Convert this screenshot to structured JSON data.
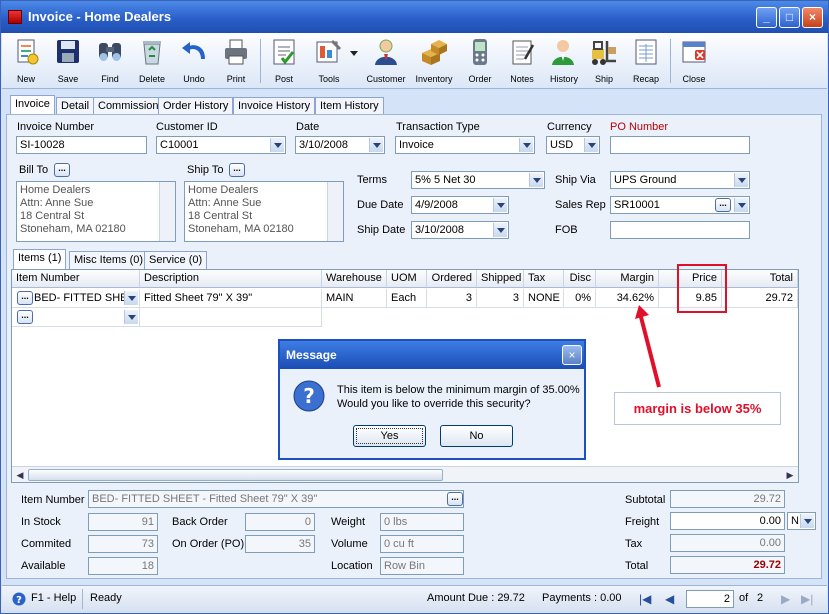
{
  "window": {
    "title": "Invoice - Home Dealers"
  },
  "toolbar": {
    "items": [
      {
        "label": "New",
        "icon": "new-document-icon"
      },
      {
        "label": "Save",
        "icon": "floppy-save-icon"
      },
      {
        "label": "Find",
        "icon": "binoculars-icon"
      },
      {
        "label": "Delete",
        "icon": "recycle-bin-icon"
      },
      {
        "label": "Undo",
        "icon": "undo-arrow-icon"
      },
      {
        "label": "Print",
        "icon": "printer-icon"
      },
      {
        "label": "Post",
        "icon": "post-check-icon"
      },
      {
        "label": "Tools",
        "icon": "tools-icon"
      },
      {
        "label": "Customer",
        "icon": "customer-icon"
      },
      {
        "label": "Inventory",
        "icon": "boxes-icon"
      },
      {
        "label": "Order",
        "icon": "order-device-icon"
      },
      {
        "label": "Notes",
        "icon": "notepad-icon"
      },
      {
        "label": "History",
        "icon": "history-person-icon"
      },
      {
        "label": "Ship",
        "icon": "forklift-icon"
      },
      {
        "label": "Recap",
        "icon": "recap-icon"
      },
      {
        "label": "Close",
        "icon": "close-window-icon"
      }
    ]
  },
  "tabs": [
    "Invoice",
    "Detail",
    "Commission",
    "Order History",
    "Invoice History",
    "Item History"
  ],
  "header": {
    "invoice_number_label": "Invoice Number",
    "invoice_number": "SI-10028",
    "customer_id_label": "Customer ID",
    "customer_id": "C10001",
    "date_label": "Date",
    "date": "3/10/2008",
    "transaction_type_label": "Transaction Type",
    "transaction_type": "Invoice",
    "currency_label": "Currency",
    "currency": "USD",
    "po_number_label": "PO Number",
    "po_number": ""
  },
  "bill_to": {
    "label": "Bill To",
    "lines": [
      "Home Dealers",
      "Attn: Anne Sue",
      "18 Central St",
      "Stoneham, MA 02180"
    ]
  },
  "ship_to": {
    "label": "Ship To",
    "lines": [
      "Home Dealers",
      "Attn: Anne Sue",
      "18 Central St",
      "Stoneham, MA 02180"
    ]
  },
  "terms": {
    "terms_label": "Terms",
    "terms": "5% 5 Net 30",
    "due_date_label": "Due Date",
    "due_date": "4/9/2008",
    "ship_date_label": "Ship Date",
    "ship_date": "3/10/2008",
    "ship_via_label": "Ship Via",
    "ship_via": "UPS Ground",
    "sales_rep_label": "Sales Rep",
    "sales_rep": "SR10001",
    "fob_label": "FOB",
    "fob": ""
  },
  "item_tabs": [
    "Items (1)",
    "Misc Items (0)",
    "Service (0)"
  ],
  "grid": {
    "columns": [
      "Item Number",
      "Description",
      "Warehouse",
      "UOM",
      "Ordered",
      "Shipped",
      "Tax",
      "Disc",
      "Margin",
      "Price",
      "Total"
    ],
    "rows": [
      {
        "item_number": "BED- FITTED SHEE",
        "description": "Fitted Sheet 79\" X 39\"",
        "warehouse": "MAIN",
        "uom": "Each",
        "ordered": "3",
        "shipped": "3",
        "tax": "NONE",
        "disc": "0%",
        "margin": "34.62%",
        "price": "9.85",
        "total": "29.72"
      }
    ]
  },
  "annotation": {
    "text": "margin is below 35%",
    "color": "#e0102a"
  },
  "dialog": {
    "title": "Message",
    "line1": "This item is below the minimum margin of 35.00%",
    "line2": "Would you like to override this security?",
    "yes": "Yes",
    "no": "No"
  },
  "footer": {
    "item_number_label": "Item Number",
    "item_number": "BED- FITTED SHEET - Fitted Sheet 79\" X 39\"",
    "in_stock_label": "In Stock",
    "in_stock": "91",
    "committed_label": "Commited",
    "committed": "73",
    "available_label": "Available",
    "available": "18",
    "back_order_label": "Back Order",
    "back_order": "0",
    "on_order_label": "On Order (PO)",
    "on_order": "35",
    "weight_label": "Weight",
    "weight": "0 lbs",
    "volume_label": "Volume",
    "volume": "0 cu ft",
    "location_label": "Location",
    "location": "Row  Bin",
    "subtotal_label": "Subtotal",
    "subtotal": "29.72",
    "freight_label": "Freight",
    "freight": "0.00",
    "freight_method": "N",
    "tax_label": "Tax",
    "tax": "0.00",
    "total_label": "Total",
    "total": "29.72"
  },
  "status": {
    "help": "F1 - Help",
    "state": "Ready",
    "amount_due": "Amount Due : 29.72",
    "payments": "Payments : 0.00",
    "page": "2",
    "of_label": "of",
    "page_count": "2"
  }
}
